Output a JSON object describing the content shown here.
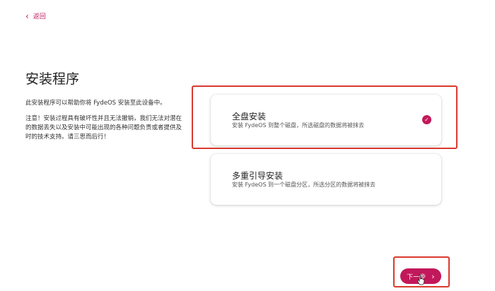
{
  "nav": {
    "back_icon": "chevron-left-icon",
    "back_icon_glyph": "‹",
    "back_label": "返回"
  },
  "page": {
    "title": "安装程序",
    "intro": "此安装程序可以帮助你将 FydeOS 安装至此设备中。",
    "warning": "注意！安装过程具有破坏性并且无法撤销，我们无法对潜在的数据丢失以及安装中可能出现的各种问题负责或者提供及时的技术支持。请三思而后行！"
  },
  "options": [
    {
      "title": "全盘安装",
      "description": "安装 FydeOS 到整个磁盘，所选磁盘的数据将被抹去",
      "selected": true
    },
    {
      "title": "多重引导安装",
      "description": "安装 FydeOS 到一个磁盘分区，所选分区的数据将被抹去",
      "selected": false
    }
  ],
  "selected_icon": "check-circle-icon",
  "selected_icon_glyph": "✓",
  "next": {
    "label": "下一步",
    "icon": "chevron-right-icon",
    "icon_glyph": "›"
  },
  "colors": {
    "accent": "#c2185b",
    "highlight_box": "#d93a2f",
    "text": "#222222",
    "background": "#ffffff"
  }
}
